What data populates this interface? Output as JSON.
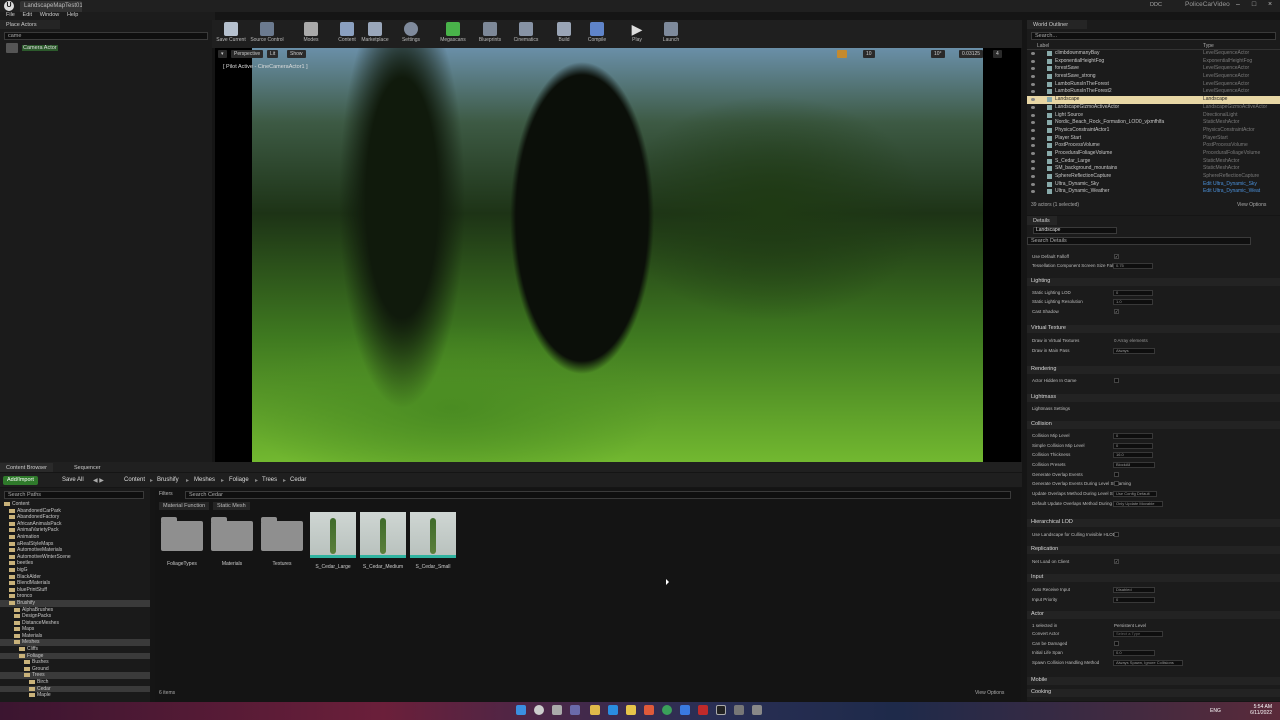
{
  "window": {
    "doc_tab": "LandscapeMapTest01",
    "menu": [
      "File",
      "Edit",
      "Window",
      "Help"
    ],
    "right_tabs": [
      "DDC",
      "PoliceCarVideo"
    ]
  },
  "place_actors": {
    "tab": "Place Actors",
    "search": "came",
    "items": [
      {
        "label": "Camera Actor"
      }
    ]
  },
  "toolbar": {
    "buttons": [
      "Save Current",
      "Source Control",
      "Modes",
      "Content",
      "Marketplace",
      "Settings",
      "Megascans",
      "Blueprints",
      "Cinematics",
      "Build",
      "Compile",
      "Play",
      "Launch"
    ]
  },
  "viewport": {
    "perspective": "Perspective",
    "lit": "Lit",
    "show": "Show",
    "pilot_label": "[ Pilot Active - CineCameraActor1 ]",
    "grid": "10",
    "angle": "10°",
    "scale": "0.03125",
    "speed": "4"
  },
  "outliner": {
    "tab": "World Outliner",
    "search_placeholder": "Search...",
    "col_label": "Label",
    "col_type": "Type",
    "rows": [
      {
        "n": "climbdownmanyBay",
        "t": "LevelSequenceActor"
      },
      {
        "n": "ExponentialHeightFog",
        "t": "ExponentialHeightFog"
      },
      {
        "n": "forestSave",
        "t": "LevelSequenceActor"
      },
      {
        "n": "forestSave_strong",
        "t": "LevelSequenceActor"
      },
      {
        "n": "LamboRunsInTheForest",
        "t": "LevelSequenceActor"
      },
      {
        "n": "LamboRunsInTheForest2",
        "t": "LevelSequenceActor"
      },
      {
        "n": "Landscape",
        "t": "Landscape",
        "sel": true
      },
      {
        "n": "LandscapeGizmoActiveActor",
        "t": "LandscapeGizmoActiveActor"
      },
      {
        "n": "Light Source",
        "t": "DirectionalLight"
      },
      {
        "n": "Nordic_Beach_Rock_Formation_LOD0_vjxmfhlfa",
        "t": "StaticMeshActor"
      },
      {
        "n": "PhysicsConstraintActor1",
        "t": "PhysicsConstraintActor"
      },
      {
        "n": "Player Start",
        "t": "PlayerStart"
      },
      {
        "n": "PostProcessVolume",
        "t": "PostProcessVolume"
      },
      {
        "n": "ProceduralFoliageVolume",
        "t": "ProceduralFoliageVolume"
      },
      {
        "n": "S_Cedar_Large",
        "t": "StaticMeshActor"
      },
      {
        "n": "SM_background_mountains",
        "t": "StaticMeshActor"
      },
      {
        "n": "SphereReflectionCapture",
        "t": "SphereReflectionCapture"
      },
      {
        "n": "Ultra_Dynamic_Sky",
        "t": "Edit Ultra_Dynamic_Sky",
        "link": true
      },
      {
        "n": "Ultra_Dynamic_Weather",
        "t": "Edit Ultra_Dynamic_Weat",
        "link": true
      }
    ],
    "count": "39 actors (1 selected)",
    "view_options": "View Options"
  },
  "details": {
    "tab": "Details",
    "selected": "Landscape",
    "search_placeholder": "Search Details",
    "sections": {
      "lighting": "Lighting",
      "virtual_texture": "Virtual Texture",
      "rendering": "Rendering",
      "lightmass": "Lightmass",
      "collision": "Collision",
      "hlod": "Hierarchical LOD",
      "replication": "Replication",
      "input": "Input",
      "actor": "Actor",
      "mobile": "Mobile",
      "cooking": "Cooking"
    },
    "props": {
      "p1": "Use Default Falloff",
      "p2": "Tessellation Component Screen Size Falloff",
      "p2v": "0.75",
      "l1": "Static Lighting LOD",
      "l1v": "0",
      "l2": "Static Lighting Resolution",
      "l2v": "1.0",
      "l3": "Cast Shadow",
      "v1": "Draw in Virtual Textures",
      "v1v": "0 Array elements",
      "v2": "Draw in Main Pass",
      "v2v": "Always",
      "r1": "Actor Hidden In Game",
      "lm1": "Lightmass Settings",
      "c1": "Collision Mip Level",
      "c1v": "0",
      "c2": "Simple Collision Mip Level",
      "c2v": "0",
      "c3": "Collision Thickness",
      "c3v": "16.0",
      "c4": "Collision Presets",
      "c4v": "BlockAll",
      "c5": "Generate Overlap Events",
      "c6": "Generate Overlap Events During Level Streaming",
      "c7": "Update Overlaps Method During Level Streaming",
      "c7v": "Use Config Default",
      "c8": "Default Update Overlaps Method During Level Streaming",
      "c8v": "Only Update Movable",
      "h1": "Use Landscape for Culling Invisible HLOD",
      "rep1": "Net Load on Client",
      "i1": "Auto Receive Input",
      "i1v": "Disabled",
      "i2": "Input Priority",
      "i2v": "0",
      "a1": "1 selected in",
      "a1v": "Persistent Level",
      "a2": "Convert Actor",
      "a2v": "Select a Type",
      "a3": "Can be Damaged",
      "a4": "Initial Life Span",
      "a4v": "0.0",
      "a5": "Spawn Collision Handling Method",
      "a5v": "Always Spawn, Ignore Collisions"
    }
  },
  "content_browser": {
    "tabs": [
      "Content Browser",
      "Sequencer"
    ],
    "add_import": "Add/Import",
    "save_all": "Save All",
    "crumbs": [
      "Content",
      "Brushify",
      "Meshes",
      "Foliage",
      "Trees",
      "Cedar"
    ],
    "search_paths": "Search Paths",
    "filters": "Filters",
    "search_assets": "Search Cedar",
    "chips": [
      "Material Function",
      "Static Mesh"
    ],
    "tree": [
      {
        "l": "Content",
        "d": 0
      },
      {
        "l": "AbandonedCarPark",
        "d": 1
      },
      {
        "l": "AbandonedFactory",
        "d": 1
      },
      {
        "l": "AfricanAnimalsPack",
        "d": 1
      },
      {
        "l": "AnimalVarietyPack",
        "d": 1
      },
      {
        "l": "Animation",
        "d": 1
      },
      {
        "l": "aRealStyleMaps",
        "d": 1
      },
      {
        "l": "AutomotiveMaterials",
        "d": 1
      },
      {
        "l": "AutomotiveWinterScene",
        "d": 1
      },
      {
        "l": "beetles",
        "d": 1
      },
      {
        "l": "bigG",
        "d": 1
      },
      {
        "l": "BlackAlder",
        "d": 1
      },
      {
        "l": "BlendMaterials",
        "d": 1
      },
      {
        "l": "bluePrintStuff",
        "d": 1
      },
      {
        "l": "bronco",
        "d": 1
      },
      {
        "l": "Brushify",
        "d": 1,
        "sel": true
      },
      {
        "l": "AlphaBrushes",
        "d": 2
      },
      {
        "l": "DesignPacks",
        "d": 2
      },
      {
        "l": "DistanceMeshes",
        "d": 2
      },
      {
        "l": "Maps",
        "d": 2
      },
      {
        "l": "Materials",
        "d": 2
      },
      {
        "l": "Meshes",
        "d": 2,
        "sel": true
      },
      {
        "l": "Cliffs",
        "d": 3
      },
      {
        "l": "Foliage",
        "d": 3,
        "sel": true
      },
      {
        "l": "Bushes",
        "d": 4
      },
      {
        "l": "Ground",
        "d": 4
      },
      {
        "l": "Trees",
        "d": 4,
        "sel": true
      },
      {
        "l": "Birch",
        "d": 5
      },
      {
        "l": "Cedar",
        "d": 5,
        "sel": true
      },
      {
        "l": "Maple",
        "d": 5
      }
    ],
    "assets": [
      {
        "name": "FoliageTypes",
        "kind": "folder"
      },
      {
        "name": "Materials",
        "kind": "folder"
      },
      {
        "name": "Textures",
        "kind": "folder"
      },
      {
        "name": "S_Cedar_Large",
        "kind": "mesh"
      },
      {
        "name": "S_Cedar_Medium",
        "kind": "mesh"
      },
      {
        "name": "S_Cedar_Small",
        "kind": "mesh"
      }
    ],
    "count": "6 items",
    "view_options": "View Options"
  },
  "taskbar": {
    "time": "5:54 AM",
    "date": "6/11/2022",
    "lang": "ENG"
  }
}
